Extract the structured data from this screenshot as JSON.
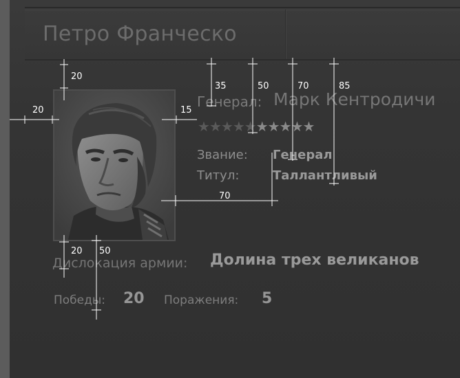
{
  "window": {
    "title": "Петро Франческо"
  },
  "general": {
    "label": "Генерал:",
    "name": "Марк Кентродичи",
    "stars_total": 10,
    "stars_lit": 5
  },
  "details": {
    "rank_label": "Звание:",
    "rank_value": "Генерал",
    "title_label": "Титул:",
    "title_value": "Таллантливый"
  },
  "army": {
    "location_label": "Дислокация армии:",
    "location_value": "Долина трех великанов"
  },
  "stats": {
    "wins_label": "Победы:",
    "wins_value": "20",
    "losses_label": "Поражения:",
    "losses_value": "5"
  },
  "dimensions": {
    "top_gap": "20",
    "left_gap": "20",
    "right_gap": "15",
    "label_offsets": [
      "35",
      "50",
      "70",
      "85"
    ],
    "column_offset": "70",
    "bottom_gap": "20",
    "bottom_offset": "50"
  }
}
